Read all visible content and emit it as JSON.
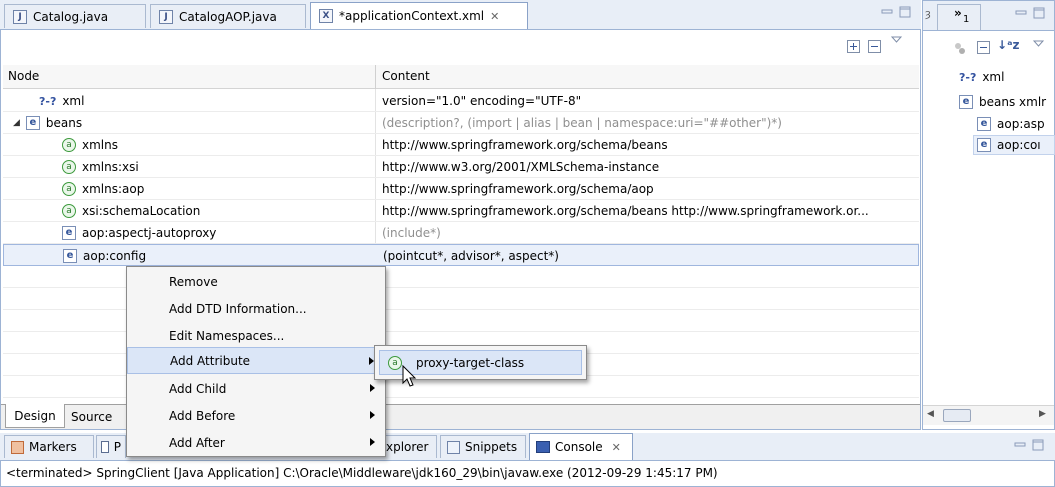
{
  "editor_tabs": [
    {
      "label": "Catalog.java",
      "icon": "J"
    },
    {
      "label": "CatalogAOP.java",
      "icon": "J"
    },
    {
      "label": "*applicationContext.xml",
      "icon": "X"
    }
  ],
  "grid": {
    "header_node": "Node",
    "header_content": "Content",
    "rows": [
      {
        "node": "xml",
        "content": "version=\"1.0\" encoding=\"UTF-8\""
      },
      {
        "node": "beans",
        "content": "(description?, (import | alias | bean | namespace:uri=\"##other\")*)"
      },
      {
        "node": "xmlns",
        "content": "http://www.springframework.org/schema/beans"
      },
      {
        "node": "xmlns:xsi",
        "content": "http://www.w3.org/2001/XMLSchema-instance"
      },
      {
        "node": "xmlns:aop",
        "content": "http://www.springframework.org/schema/aop"
      },
      {
        "node": "xsi:schemaLocation",
        "content": "http://www.springframework.org/schema/beans http://www.springframework.or..."
      },
      {
        "node": "aop:aspectj-autoproxy",
        "content": "(include*)"
      },
      {
        "node": "aop:config",
        "content": "(pointcut*, advisor*, aspect*)"
      }
    ]
  },
  "icon_text": {
    "pi": "?-?",
    "element": "e",
    "attribute": "a"
  },
  "bottom_tabs": {
    "design": "Design",
    "source": "Source"
  },
  "context_menu": {
    "items": [
      "Remove",
      "Add DTD Information...",
      "Edit Namespaces...",
      "Add Attribute",
      "Add Child",
      "Add Before",
      "Add After"
    ]
  },
  "submenu": {
    "item": "proxy-target-class"
  },
  "outline": {
    "items": [
      "xml",
      "beans xmlr",
      "aop:asp",
      "aop:coı"
    ],
    "tab_label": "1"
  },
  "console": {
    "tabs": [
      "Markers",
      "P",
      "xplorer",
      "Snippets",
      "Console"
    ],
    "status": "<terminated> SpringClient [Java Application] C:\\Oracle\\Middleware\\jdk160_29\\bin\\javaw.exe (2012-09-29 1:45:17 PM)"
  }
}
